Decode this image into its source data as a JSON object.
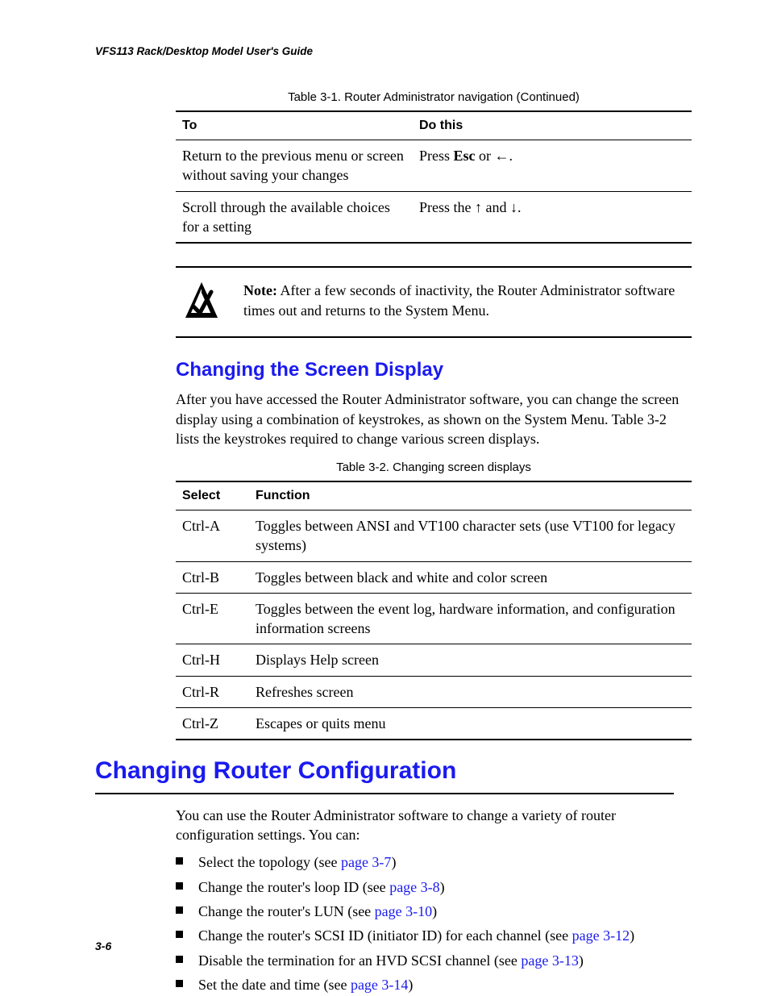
{
  "running_head": "VFS113 Rack/Desktop Model User's Guide",
  "page_num": "3-6",
  "table1": {
    "caption": "Table 3-1. Router Administrator navigation (Continued)",
    "headers": [
      "To",
      "Do this"
    ],
    "rows": [
      {
        "to": "Return to the previous menu or screen without saving your changes",
        "do_pre": "Press ",
        "do_bold": "Esc",
        "do_post": " or ",
        "do_sym": "←",
        "do_end": "."
      },
      {
        "to": "Scroll through the available choices for a setting",
        "do_pre": "Press the ",
        "do_sym": "↑",
        "do_mid": " and ",
        "do_sym2": "↓",
        "do_end": "."
      }
    ]
  },
  "note": {
    "label": "Note:",
    "text": " After a few seconds of inactivity, the Router Administrator software times out and returns to the System Menu."
  },
  "sec1": {
    "title": "Changing the Screen Display",
    "para": "After you have accessed the Router Administrator software, you can change the screen display using a combination of keystrokes, as shown on the System Menu. Table 3-2 lists the keystrokes required to change various screen displays."
  },
  "table2": {
    "caption": "Table 3-2. Changing screen displays",
    "headers": [
      "Select",
      "Function"
    ],
    "rows": [
      {
        "k": "Ctrl-A",
        "f": "Toggles between ANSI and VT100 character sets (use VT100 for legacy systems)"
      },
      {
        "k": "Ctrl-B",
        "f": "Toggles between black and white and color screen"
      },
      {
        "k": "Ctrl-E",
        "f": "Toggles between the event log, hardware information, and configuration information screens"
      },
      {
        "k": "Ctrl-H",
        "f": "Displays Help screen"
      },
      {
        "k": "Ctrl-R",
        "f": "Refreshes screen"
      },
      {
        "k": "Ctrl-Z",
        "f": "Escapes or quits menu"
      }
    ]
  },
  "sec2": {
    "title": "Changing Router Configuration",
    "para": "You can use the Router Administrator software to change a variety of router configuration settings. You can:",
    "items": [
      {
        "pre": "Select the topology (see ",
        "link": "page 3-7",
        "post": ")"
      },
      {
        "pre": "Change the router's loop ID (see ",
        "link": "page 3-8",
        "post": ")"
      },
      {
        "pre": "Change the router's LUN (see ",
        "link": "page 3-10",
        "post": ")"
      },
      {
        "pre": "Change the router's SCSI ID (initiator ID) for each channel (see ",
        "link": "page 3-12",
        "post": ")"
      },
      {
        "pre": "Disable the termination for an HVD SCSI channel (see ",
        "link": "page 3-13",
        "post": ")"
      },
      {
        "pre": "Set the date and time (see ",
        "link": "page 3-14",
        "post": ")"
      }
    ]
  }
}
